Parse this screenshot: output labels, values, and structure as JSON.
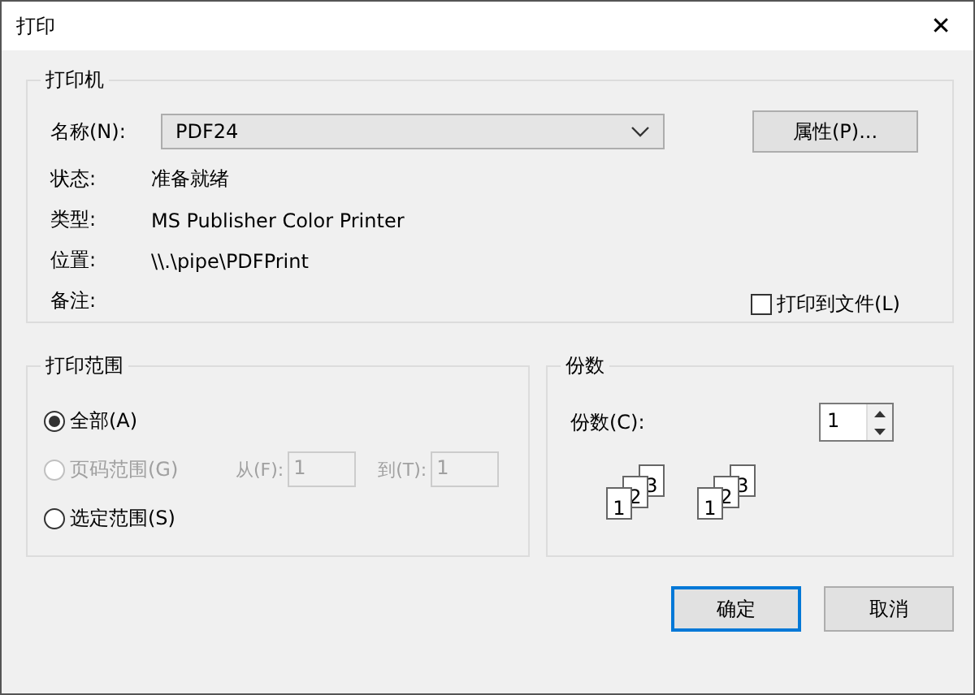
{
  "window": {
    "title": "打印",
    "close": "✕"
  },
  "printer": {
    "title": "打印机",
    "name_label": "名称(N):",
    "name_value": "PDF24",
    "properties_button": "属性(P)...",
    "info": [
      {
        "label": "状态:",
        "value": "准备就绪"
      },
      {
        "label": "类型:",
        "value": "MS Publisher Color Printer"
      },
      {
        "label": "位置:",
        "value": "\\\\.\\pipe\\PDFPrint"
      },
      {
        "label": "备注:"
      }
    ],
    "print_to_file": {
      "label": "打印到文件(L)",
      "checked": false
    }
  },
  "range": {
    "title": "打印范围",
    "options": [
      {
        "label": "全部(A)",
        "selected": true,
        "disabled": false
      },
      {
        "label": "页码范围(G)",
        "selected": false,
        "disabled": true,
        "from_label": "从(F):",
        "from_value": "1",
        "to_label": "到(T):",
        "to_value": "1"
      },
      {
        "label": "选定范围(S)",
        "selected": false,
        "disabled": false
      }
    ]
  },
  "copies": {
    "title": "份数",
    "label": "份数(C):",
    "value": "1",
    "collate_sets": [
      {
        "pages": [
          "1",
          "2",
          "3"
        ]
      },
      {
        "pages": [
          "1",
          "2",
          "3"
        ]
      }
    ]
  },
  "buttons": [
    {
      "label": "确定",
      "default": true
    },
    {
      "label": "取消",
      "default": false
    }
  ]
}
